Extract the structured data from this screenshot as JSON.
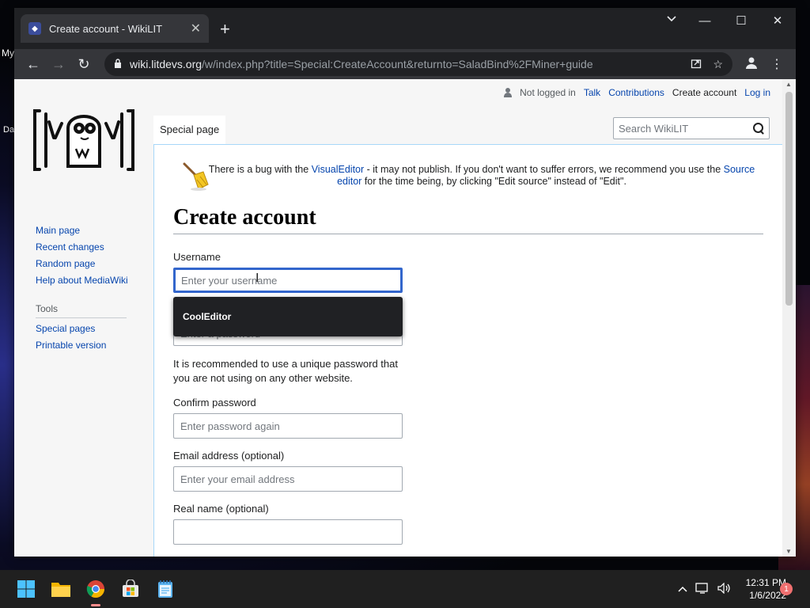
{
  "desktop": {
    "labels": [
      "My",
      "Da"
    ]
  },
  "browser": {
    "tab_title": "Create account - WikiLIT",
    "tab_close": "✕",
    "new_tab": "+",
    "tab_search_icon": "chevron-down-icon",
    "window_controls": {
      "minimize": "—",
      "maximize": "☐",
      "close": "✕"
    },
    "url_host": "wiki.litdevs.org",
    "url_path": "/w/index.php?title=Special:CreateAccount&returnto=SaladBind%2FMiner+guide",
    "nav": {
      "back": "←",
      "forward": "→",
      "reload": "↻"
    }
  },
  "wiki": {
    "personal": {
      "status": "Not logged in",
      "links": [
        "Talk",
        "Contributions",
        "Create account",
        "Log in"
      ]
    },
    "namespace_tab": "Special page",
    "search_placeholder": "Search WikiLIT",
    "sidebar": {
      "nav_links": [
        "Main page",
        "Recent changes",
        "Random page",
        "Help about MediaWiki"
      ],
      "tools_heading": "Tools",
      "tools_links": [
        "Special pages",
        "Printable version"
      ]
    },
    "notice": {
      "part1": "There is a bug with the ",
      "link1": "VisualEditor",
      "part2": " - it may not publish. If you don't want to suffer errors, we recommend you use the ",
      "link2": "Source editor",
      "part3": " for the time being, by clicking \"Edit source\" instead of \"Edit\"."
    },
    "page_title": "Create account",
    "form": {
      "username_label": "Username",
      "username_placeholder": "Enter your username",
      "autocomplete_suggestion": "CoolEditor",
      "password_placeholder": "Enter a password",
      "password_hint": "It is recommended to use a unique password that you are not using on any other website.",
      "confirm_label": "Confirm password",
      "confirm_placeholder": "Enter password again",
      "email_label": "Email address (optional)",
      "email_placeholder": "Enter your email address",
      "realname_label": "Real name (optional)",
      "realname_placeholder": ""
    }
  },
  "taskbar": {
    "time": "12:31 PM",
    "date": "1/6/2022",
    "notification_count": "1",
    "apps": [
      "start-icon",
      "file-explorer-icon",
      "chrome-icon",
      "store-icon",
      "notepad-icon"
    ]
  },
  "colors": {
    "link": "#0645ad",
    "accent": "#36c",
    "chrome_dark": "#202124"
  }
}
